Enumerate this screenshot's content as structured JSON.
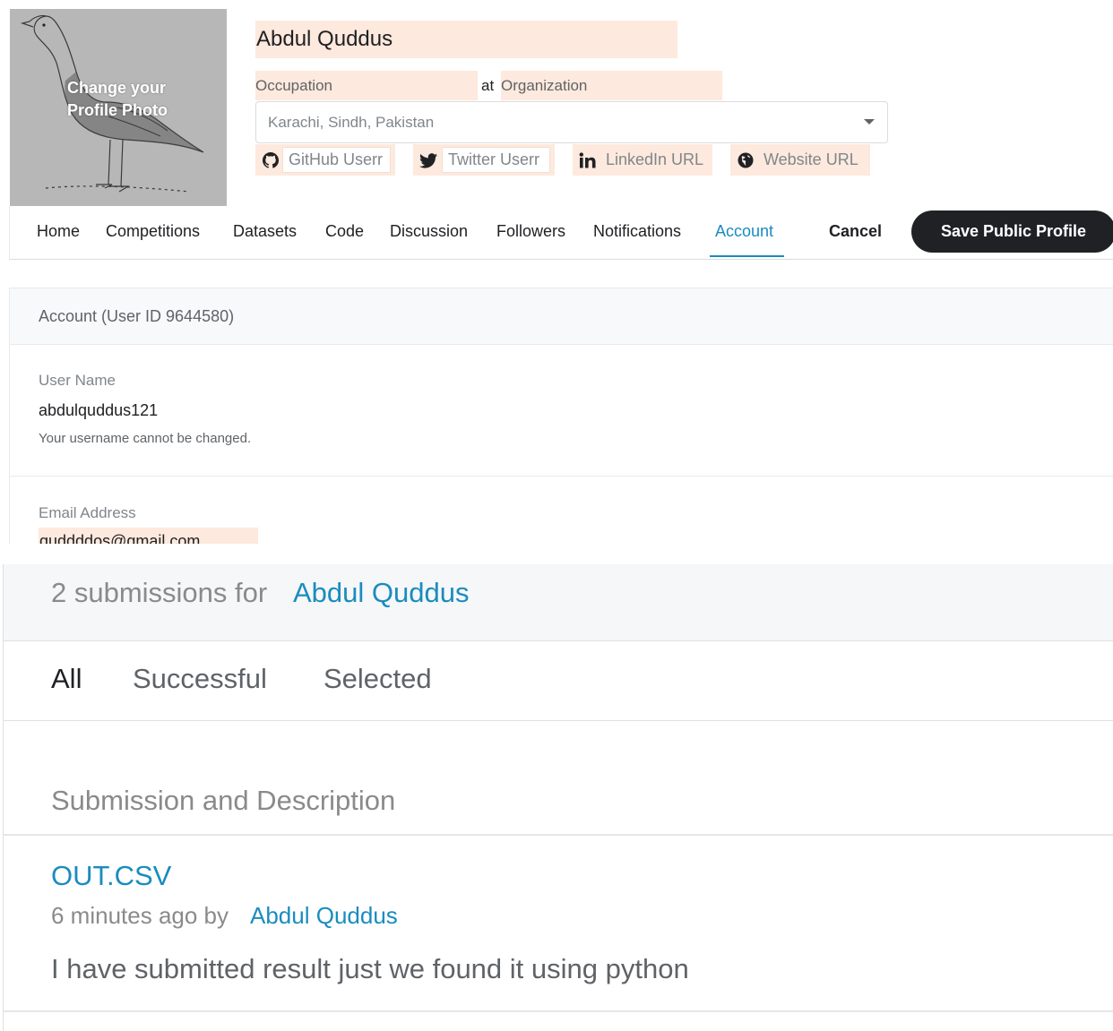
{
  "profile": {
    "photo_label_line1": "Change your",
    "photo_label_line2": "Profile Photo",
    "name": "Abdul Quddus",
    "occupation_placeholder": "Occupation",
    "at_label": "at",
    "organization_placeholder": "Organization",
    "location": "Karachi, Sindh, Pakistan",
    "social": {
      "github_placeholder": "GitHub Userr",
      "twitter_placeholder": "Twitter Userr",
      "linkedin_placeholder": "LinkedIn URL",
      "website_placeholder": "Website URL"
    },
    "highlight_color": "#fde9dd"
  },
  "nav": {
    "items": [
      "Home",
      "Competitions",
      "Datasets",
      "Code",
      "Discussion",
      "Followers",
      "Notifications",
      "Account"
    ],
    "active": "Account",
    "cancel_label": "Cancel",
    "save_label": "Save Public Profile",
    "accent_color": "#1a8cbf"
  },
  "account": {
    "header": "Account (User ID 9644580)",
    "username_label": "User Name",
    "username_value": "abdulquddus121",
    "username_help": "Your username cannot be changed.",
    "email_label": "Email Address",
    "email_value": "quddddos@gmail.com"
  },
  "submissions": {
    "count_text": "2 submissions for",
    "user_name": "Abdul Quddus",
    "tabs": [
      "All",
      "Successful",
      "Selected"
    ],
    "active_tab": "All",
    "column_header": "Submission and Description",
    "items": [
      {
        "file": "OUT.CSV",
        "time": "6 minutes ago by",
        "author": "Abdul Quddus",
        "description": "I have submitted result just we found it using python"
      }
    ]
  }
}
